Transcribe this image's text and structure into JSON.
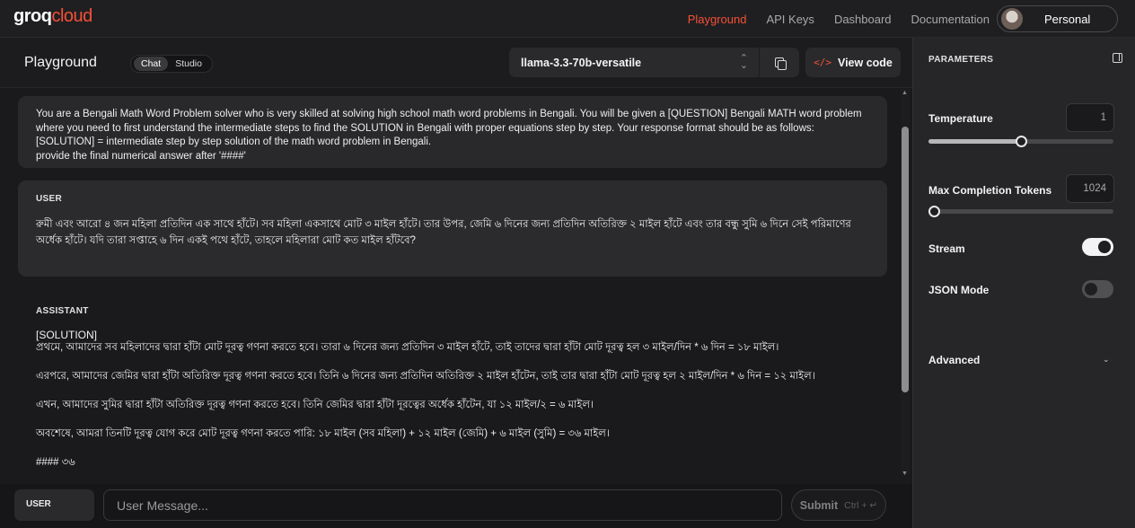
{
  "nav": {
    "logo_groq": "groq",
    "logo_cloud": "cloud",
    "links": [
      "Playground",
      "API Keys",
      "Dashboard",
      "Documentation"
    ],
    "active": "Playground",
    "profile_label": "Personal"
  },
  "header": {
    "title": "Playground",
    "modes": [
      "Chat",
      "Studio"
    ],
    "active_mode": "Chat",
    "model": "llama-3.3-70b-versatile",
    "view_code_label": "View code"
  },
  "messages": {
    "system_text": "You are a Bengali Math Word Problem solver who is very skilled at solving high school math word problems in Bengali. You will be given a [QUESTION] Bengali MATH word problem where you need to first understand the intermediate steps to find the SOLUTION in Bengali with proper equations step by step. Your response format should be as follows: [SOLUTION] = intermediate step by step solution of the math word problem in Bengali.\nprovide the final numerical answer after '####'",
    "user_role": "USER",
    "user_text": "রুমী এবং আরো ৪ জন মহিলা প্রতিদিন এক সাথে হাঁটে। সব মহিলা একসাথে মোট ৩ মাইল হাঁটে। তার উপর, জেমি ৬ দিনের জন্য প্রতিদিন অতিরিক্ত ২ মাইল হাঁটে এবং তার বন্ধু সুমি ৬ দিনে সেই পরিমাণের অর্ধেক হাঁটে। যদি তারা সপ্তাহে ৬ দিন একই পথে হাঁটে, তাহলে মহিলারা মোট কত মাইল হাঁটবে?",
    "assistant_role": "ASSISTANT",
    "assistant_solution_tag": "[SOLUTION]",
    "assistant_lines": [
      "প্রথমে, আমাদের সব মহিলাদের দ্বারা হাঁটা মোট দূরত্ব গণনা করতে হবে। তারা ৬ দিনের জন্য প্রতিদিন ৩ মাইল হাঁটে, তাই তাদের দ্বারা হাঁটা মোট দূরত্ব হল ৩ মাইল/দিন * ৬ দিন = ১৮ মাইল।",
      "এরপরে, আমাদের জেমির দ্বারা হাঁটা অতিরিক্ত দূরত্ব গণনা করতে হবে। তিনি ৬ দিনের জন্য প্রতিদিন অতিরিক্ত ২ মাইল হাঁটেন, তাই তার দ্বারা হাঁটা মোট দূরত্ব হল ২ মাইল/দিন * ৬ দিন = ১২ মাইল।",
      "এখন, আমাদের সুমির দ্বারা হাঁটা অতিরিক্ত দূরত্ব গণনা করতে হবে। তিনি জেমির দ্বারা হাঁটা দূরত্বের অর্ধেক হাঁটেন, যা ১২ মাইল/২ = ৬ মাইল।",
      "অবশেষে, আমরা তিনটি দূরত্ব যোগ করে মোট দূরত্ব গণনা করতে পারি: ১৮ মাইল (সব মহিলা) + ১২ মাইল (জেমি) + ৬ মাইল (সুমি) = ৩৬ মাইল।",
      "#### ৩৬"
    ]
  },
  "composer": {
    "role": "USER",
    "placeholder": "User Message...",
    "submit_label": "Submit",
    "shortcut": "Ctrl + ↵"
  },
  "parameters": {
    "title": "PARAMETERS",
    "temperature_label": "Temperature",
    "temperature_value": "1",
    "temperature_fraction": 0.5,
    "max_tokens_label": "Max Completion Tokens",
    "max_tokens_value": "1024",
    "max_tokens_fraction": 0.03,
    "stream_label": "Stream",
    "stream_on": true,
    "json_mode_label": "JSON Mode",
    "json_mode_on": false,
    "advanced_label": "Advanced"
  },
  "colors": {
    "accent": "#f55036",
    "background": "#141416",
    "panel": "#262628"
  },
  "icons": [
    "copy-icon",
    "code-icon",
    "chevron-updown-icon",
    "panel-toggle-icon",
    "chevron-down-icon"
  ]
}
